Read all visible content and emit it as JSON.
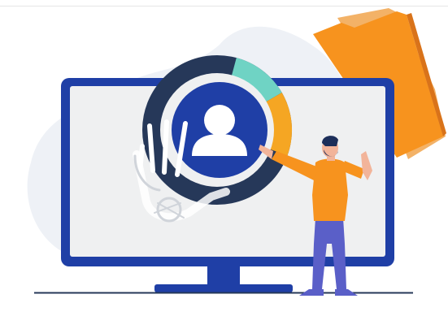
{
  "illustration": {
    "subject": "",
    "colors": {
      "monitor_frame": "#1f3fa6",
      "screen": "#eff0f1",
      "blob": "#eef1f6",
      "ring_dark": "#263859",
      "ring_teal": "#6fd3c4",
      "ring_orange": "#f5a623",
      "avatar_disc": "#1f3fa6",
      "folder": "#f7931e",
      "shirt": "#f7931e",
      "pants": "#5a5fc8",
      "skin": "#f2b49a",
      "hair": "#1c2e5a"
    },
    "icons": [
      "user-avatar-icon",
      "folder-icon",
      "hand-xray-icon"
    ]
  }
}
